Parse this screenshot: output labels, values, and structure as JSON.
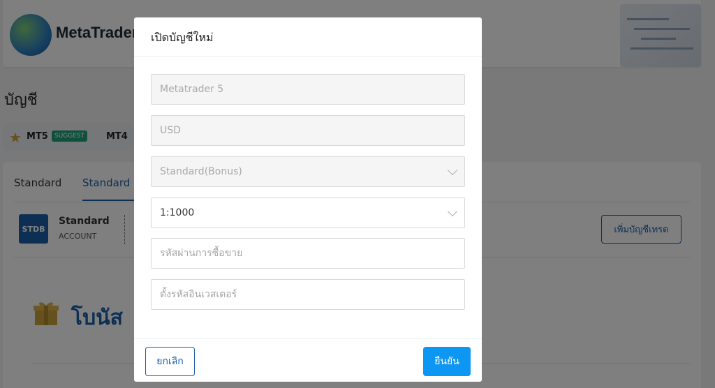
{
  "background": {
    "brand": "MetaTrader",
    "page_title": "บัญชี",
    "platforms": [
      {
        "label": "MT5",
        "badge": "SUGGEST"
      },
      {
        "label": "MT4"
      }
    ],
    "tabs": [
      {
        "label": "Standard"
      },
      {
        "label": "Standard (",
        "active": true
      }
    ],
    "account": {
      "icon_label": "STDB",
      "name": "Standard",
      "sub": "ACCOUNT"
    },
    "add_account_button": "เพิ่มบัญชีเทรด",
    "bonus_title": "โบนัส",
    "colors": {
      "accent": "#1a5ea8",
      "badge": "#1fa17b",
      "star": "#c9a23a"
    }
  },
  "modal": {
    "title": "เปิดบัญชีใหม่",
    "fields": {
      "platform": {
        "value": "Metatrader 5",
        "disabled": true
      },
      "currency": {
        "value": "USD",
        "disabled": true
      },
      "account_type": {
        "value": "Standard(Bonus)",
        "disabled": true
      },
      "leverage": {
        "value": "1:1000"
      },
      "trading_password": {
        "placeholder": "รหัสผ่านการซื้อขาย"
      },
      "investor_password": {
        "placeholder": "ตั้งรหัสอินเวสเตอร์"
      }
    },
    "cancel_label": "ยกเลิก",
    "confirm_label": "ยืนยัน",
    "colors": {
      "confirm": "#0d96f2",
      "outline": "#1a5ea8"
    }
  }
}
